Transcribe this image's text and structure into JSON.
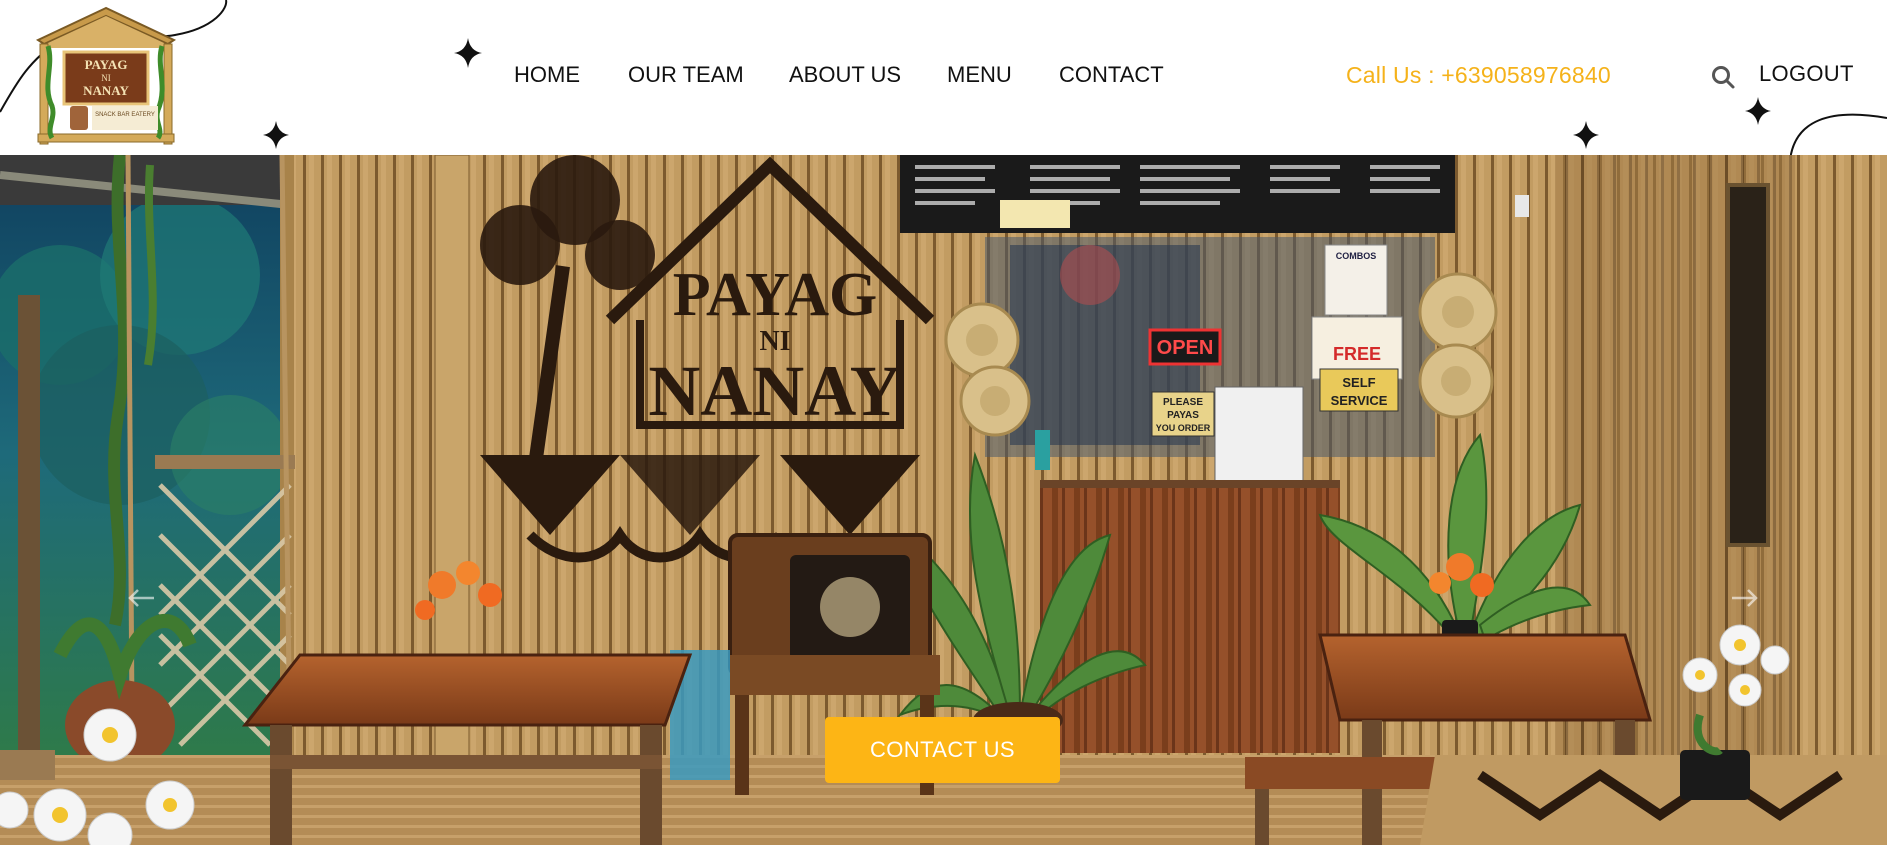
{
  "logo": {
    "line1": "PAYAG",
    "line2": "NI",
    "line3": "NANAY",
    "tagline": "SNACK BAR EATERY"
  },
  "nav": {
    "items": [
      "HOME",
      "OUR TEAM",
      "ABOUT US",
      "MENU",
      "CONTACT"
    ]
  },
  "header": {
    "phone": "Call Us : +639058976840",
    "logout": "LOGOUT",
    "icon": "search-icon"
  },
  "hero": {
    "wall_sign_line1": "PAYAG",
    "wall_sign_line2": "NI",
    "wall_sign_line3": "NANAY",
    "open_sign": "OPEN",
    "please_sign_1": "PLEASE",
    "please_sign_2": "PAYAS",
    "please_sign_3": "YOU ORDER",
    "combos_sign": "COMBOS",
    "promo_sign": "FREE",
    "self_service_1": "SELF",
    "self_service_2": "SERVICE",
    "cta": "CONTACT US"
  },
  "colors": {
    "accent": "#fdb515",
    "phone": "#f5b21a",
    "text": "#111111"
  }
}
